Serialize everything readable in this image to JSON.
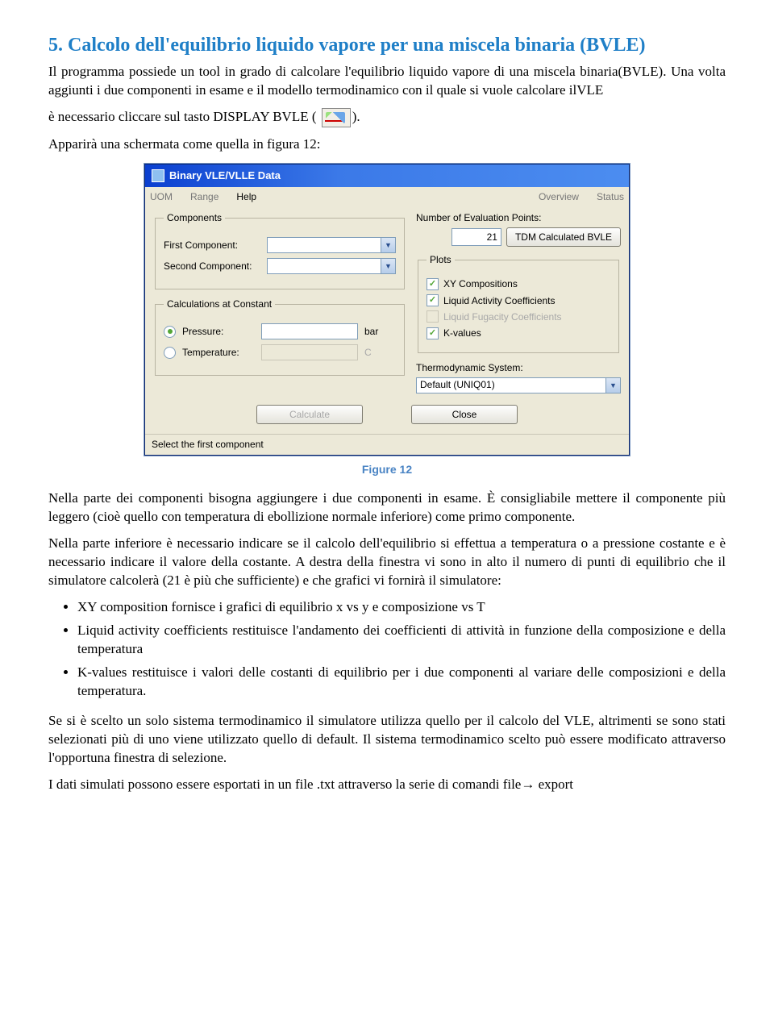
{
  "heading": "5. Calcolo dell'equilibrio liquido vapore per una miscela binaria (BVLE)",
  "intro": "Il programma possiede un tool in grado di calcolare l'equilibrio liquido vapore di una miscela binaria(BVLE). Una volta aggiunti i due componenti in esame e il modello termodinamico con il quale si vuole calcolare ilVLE",
  "click_prefix": "è necessario cliccare sul tasto DISPLAY BVLE (",
  "click_suffix": ").",
  "appear": "Apparirà una schermata come quella in figura 12:",
  "dialog": {
    "title": "Binary VLE/VLLE Data",
    "menu": {
      "uom": "UOM",
      "range": "Range",
      "help": "Help",
      "overview": "Overview",
      "status": "Status"
    },
    "components": {
      "legend": "Components",
      "first_label": "First Component:",
      "second_label": "Second Component:"
    },
    "calc": {
      "legend": "Calculations at Constant",
      "pressure": "Pressure:",
      "pressure_unit": "bar",
      "temperature": "Temperature:",
      "temperature_unit": "C"
    },
    "eval_label": "Number of Evaluation Points:",
    "eval_value": "21",
    "tdm_btn": "TDM Calculated BVLE",
    "plots": {
      "legend": "Plots",
      "xy": "XY Compositions",
      "liq_act": "Liquid Activity Coefficients",
      "liq_fug": "Liquid Fugacity Coefficients",
      "kval": "K-values"
    },
    "thermo_label": "Thermodynamic System:",
    "thermo_value": "Default (UNIQ01)",
    "calculate_btn": "Calculate",
    "close_btn": "Close",
    "status": "Select the first component"
  },
  "fig_caption": "Figure 12",
  "para1": "Nella parte dei componenti bisogna aggiungere i due componenti in esame. È consigliabile mettere il componente più leggero (cioè quello con temperatura di ebollizione normale inferiore) come primo componente.",
  "para2": "Nella parte inferiore è necessario indicare se il calcolo dell'equilibrio si effettua a temperatura o a pressione costante e è necessario indicare il valore della costante. A destra della finestra vi sono in alto il numero di punti di equilibrio che il simulatore calcolerà (21 è più che sufficiente) e che grafici vi fornirà il simulatore:",
  "bullets": {
    "a": "XY composition fornisce i grafici di equilibrio x vs y e composizione vs T",
    "b": "Liquid activity coefficients restituisce l'andamento dei coefficienti di attività in funzione della composizione e della temperatura",
    "c": "K-values restituisce i valori delle costanti di equilibrio per i due componenti al variare delle composizioni e della temperatura."
  },
  "para3": "Se si è scelto un solo sistema termodinamico il simulatore utilizza quello per il calcolo del VLE, altrimenti se sono stati selezionati più di uno viene utilizzato quello di default. Il sistema termodinamico scelto può essere modificato attraverso l'opportuna finestra di selezione.",
  "para4": "I dati simulati possono essere esportati in un file .txt attraverso la serie di comandi file→ export"
}
